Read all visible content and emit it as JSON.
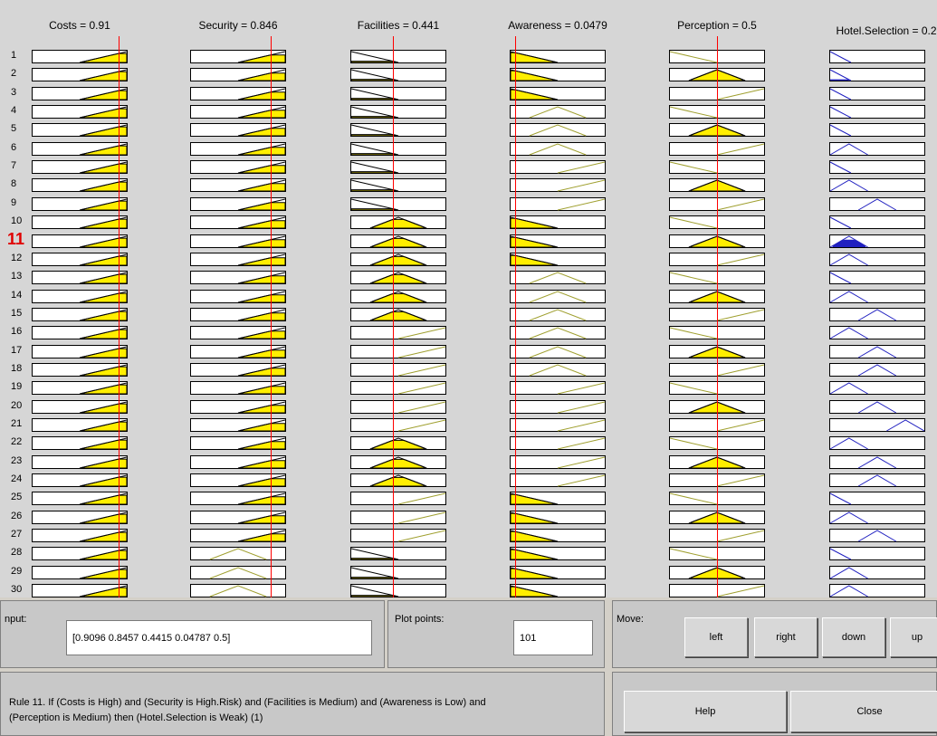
{
  "columns": [
    {
      "id": "costs",
      "title": "Costs = 0.91"
    },
    {
      "id": "security",
      "title": "Security = 0.846"
    },
    {
      "id": "facilities",
      "title": "Facilities = 0.441"
    },
    {
      "id": "awareness",
      "title": "Awareness = 0.0479"
    },
    {
      "id": "perception",
      "title": "Perception = 0.5"
    },
    {
      "id": "hotel",
      "title": "Hotel.Selection = 0.2"
    }
  ],
  "current_inputs": [
    0.91,
    0.846,
    0.441,
    0.0479,
    0.5
  ],
  "rows": [
    {
      "n": "1",
      "mf": [
        "H",
        "H",
        "L",
        "L",
        "L",
        "W1"
      ]
    },
    {
      "n": "2",
      "mf": [
        "H",
        "H",
        "L",
        "L",
        "M",
        "W1"
      ]
    },
    {
      "n": "3",
      "mf": [
        "H",
        "H",
        "L",
        "L",
        "H",
        "W1"
      ]
    },
    {
      "n": "4",
      "mf": [
        "H",
        "H",
        "L",
        "M",
        "L",
        "W1"
      ]
    },
    {
      "n": "5",
      "mf": [
        "H",
        "H",
        "L",
        "M",
        "M",
        "W1"
      ]
    },
    {
      "n": "6",
      "mf": [
        "H",
        "H",
        "L",
        "M",
        "H",
        "W2"
      ]
    },
    {
      "n": "7",
      "mf": [
        "H",
        "H",
        "L",
        "H",
        "L",
        "W1"
      ]
    },
    {
      "n": "8",
      "mf": [
        "H",
        "H",
        "L",
        "H",
        "M",
        "W2"
      ]
    },
    {
      "n": "9",
      "mf": [
        "H",
        "H",
        "L",
        "H",
        "H",
        "M"
      ]
    },
    {
      "n": "10",
      "mf": [
        "H",
        "H",
        "M",
        "L",
        "L",
        "W1"
      ]
    },
    {
      "n": "11",
      "mf": [
        "H",
        "H",
        "M",
        "L",
        "M",
        "W2"
      ]
    },
    {
      "n": "12",
      "mf": [
        "H",
        "H",
        "M",
        "L",
        "H",
        "W2"
      ]
    },
    {
      "n": "13",
      "mf": [
        "H",
        "H",
        "M",
        "M",
        "L",
        "W1"
      ]
    },
    {
      "n": "14",
      "mf": [
        "H",
        "H",
        "M",
        "M",
        "M",
        "W2"
      ]
    },
    {
      "n": "15",
      "mf": [
        "H",
        "H",
        "M",
        "M",
        "H",
        "M"
      ]
    },
    {
      "n": "16",
      "mf": [
        "H",
        "H",
        "H",
        "M",
        "L",
        "W2"
      ]
    },
    {
      "n": "17",
      "mf": [
        "H",
        "H",
        "H",
        "M",
        "M",
        "M"
      ]
    },
    {
      "n": "18",
      "mf": [
        "H",
        "H",
        "H",
        "M",
        "H",
        "M"
      ]
    },
    {
      "n": "19",
      "mf": [
        "H",
        "H",
        "H",
        "H",
        "L",
        "W2"
      ]
    },
    {
      "n": "20",
      "mf": [
        "H",
        "H",
        "H",
        "H",
        "M",
        "M"
      ]
    },
    {
      "n": "21",
      "mf": [
        "H",
        "H",
        "H",
        "H",
        "H",
        "S"
      ]
    },
    {
      "n": "22",
      "mf": [
        "H",
        "H",
        "M",
        "H",
        "L",
        "W2"
      ]
    },
    {
      "n": "23",
      "mf": [
        "H",
        "H",
        "M",
        "H",
        "M",
        "M"
      ]
    },
    {
      "n": "24",
      "mf": [
        "H",
        "H",
        "M",
        "H",
        "H",
        "M"
      ]
    },
    {
      "n": "25",
      "mf": [
        "H",
        "H",
        "H",
        "L",
        "L",
        "W1"
      ]
    },
    {
      "n": "26",
      "mf": [
        "H",
        "H",
        "H",
        "L",
        "M",
        "W2"
      ]
    },
    {
      "n": "27",
      "mf": [
        "H",
        "H",
        "H",
        "L",
        "H",
        "M"
      ]
    },
    {
      "n": "28",
      "mf": [
        "H",
        "M",
        "L",
        "L",
        "L",
        "W1"
      ]
    },
    {
      "n": "29",
      "mf": [
        "H",
        "M",
        "L",
        "L",
        "M",
        "W2"
      ]
    },
    {
      "n": "30",
      "mf": [
        "H",
        "M",
        "L",
        "L",
        "H",
        "W2"
      ]
    }
  ],
  "active_rule": "11",
  "input": {
    "label": "nput:",
    "value": "[0.9096 0.8457 0.4415 0.04787 0.5]"
  },
  "plot_points": {
    "label": "Plot points:",
    "value": "101"
  },
  "move": {
    "label": "Move:",
    "left": "left",
    "right": "right",
    "down": "down",
    "up": "up"
  },
  "rule_text": {
    "line1": "Rule 11. If (Costs is High) and (Security is High.Risk) and (Facilities is Medium) and (Awareness is Low) and",
    "line2": "(Perception is Medium) then (Hotel.Selection is Weak) (1)"
  },
  "buttons": {
    "help": "Help",
    "close": "Close"
  },
  "colors": {
    "fill": "#ffee00",
    "outline": "#000000",
    "inactive": "#a0a030",
    "output_line": "#2020c0",
    "input_line": "#ff0000",
    "active_rule": "#e00000"
  }
}
